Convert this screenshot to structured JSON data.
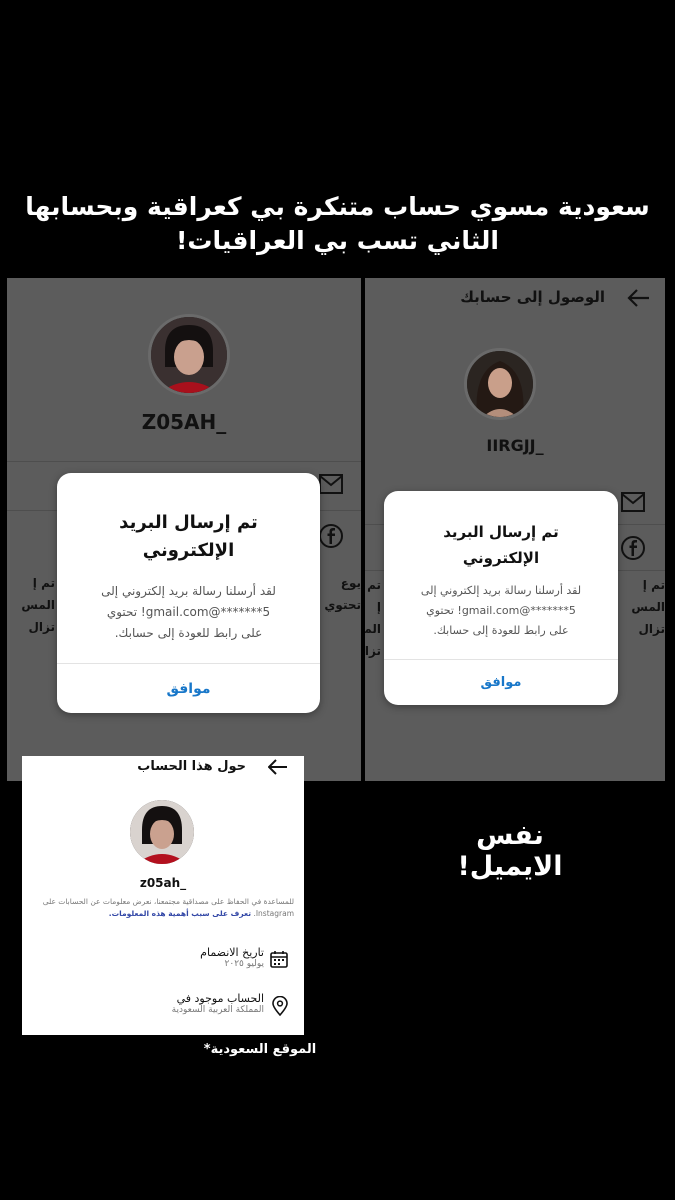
{
  "caption": {
    "line1": "سعودية مسوي حساب متنكرة بي كعراقية وبحسابها",
    "line2": "الثاني تسب بي العراقيات!"
  },
  "left_screen": {
    "username": "Z05AH_",
    "bg_fragments": [
      "تم إ",
      "المس",
      "تزال"
    ],
    "bg_fragments_right": [
      "يوع",
      "تحتوي لا",
      ""
    ],
    "modal": {
      "title_line1": "تم إرسال البريد",
      "title_line2": "الإلكتروني",
      "body_line1": "لقد أرسلنا رسالة بريد إلكتروني إلى",
      "body_line2": "5*******@gmail.com! تحتوي",
      "body_line3": "على رابط للعودة إلى حسابك.",
      "ok_label": "موافق"
    }
  },
  "right_screen": {
    "header_title": "الوصول إلى حسابك",
    "username": "IIRGJJ_",
    "bg_fragments": [
      "تم إ",
      "المس",
      "تزال"
    ],
    "modal": {
      "title_line1": "تم إرسال البريد",
      "title_line2": "الإلكتروني",
      "body_line1": "لقد أرسلنا رسالة بريد إلكتروني إلى",
      "body_line2": "5*******@gmail.com! تحتوي",
      "body_line3": "على رابط للعودة إلى حسابك.",
      "ok_label": "موافق"
    }
  },
  "about_card": {
    "header_title": "حول هذا الحساب",
    "username": "z05ah_",
    "description": "للمساعدة في الحفاظ على مصداقية مجتمعنا، نعرض معلومات عن الحسابات على Instagram.",
    "learn_more": "تعرف على سبب أهمية هذه المعلومات.",
    "joined_label": "تاريخ الانضمام",
    "joined_value": "يوليو ٢٠٢٥",
    "location_label": "الحساب موجود في",
    "location_value": "المملكة العربية السعودية"
  },
  "same_email_note": "نفس الايميل!",
  "footnote": "الموقع السعودية*"
}
